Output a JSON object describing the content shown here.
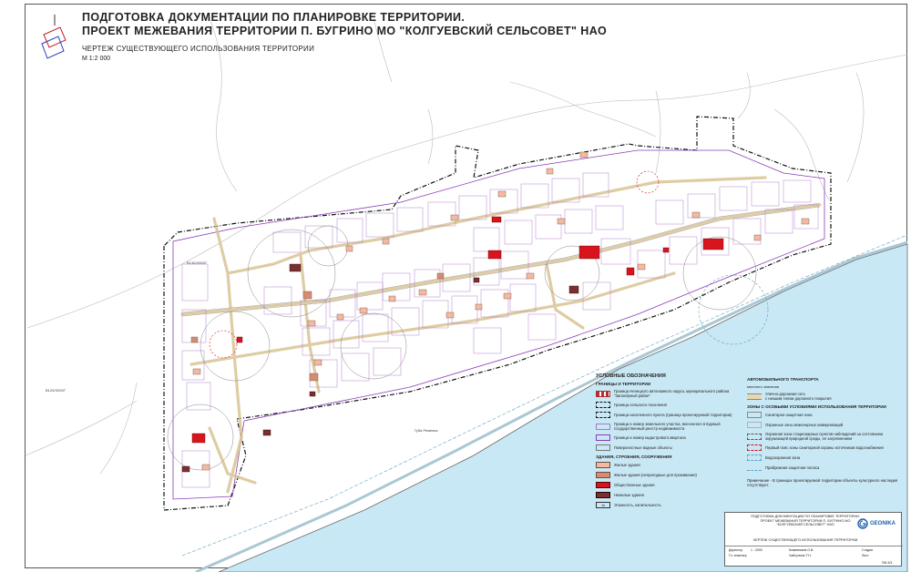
{
  "title": {
    "line1": "ПОДГОТОВКА ДОКУМЕНТАЦИИ ПО ПЛАНИРОВКЕ ТЕРРИТОРИИ.",
    "line2": "ПРОЕКТ МЕЖЕВАНИЯ ТЕРРИТОРИИ  П. БУГРИНО МО \"КОЛГУЕВСКИЙ СЕЛЬСОВЕТ\" НАО",
    "subtitle": "ЧЕРТЕЖ СУЩЕСТВУЮЩЕГО ИСПОЛЬЗОВАНИЯ ТЕРРИТОРИИ",
    "scale": "М 1:2 000"
  },
  "map_labels": {
    "gulf": "Губа Ременка",
    "coord_left": "В120/Х0007",
    "coord_top": "В130/Х0007"
  },
  "colors": {
    "water": "#c9e8f5",
    "residential": "#f4b9a1",
    "residential_unused": "#d58c73",
    "public": "#d8141d",
    "nonresidential": "#7a3030",
    "boundary_purple": "#8a3bb8",
    "road": "#e8d8b0",
    "river": "#aee0f2"
  },
  "legend": {
    "heading": "УСЛОВНЫЕ ОБОЗНАЧЕНИЯ",
    "section_borders": "ГРАНИЦЫ И ТЕРРИТОРИИ",
    "borders": [
      "Граница Ненецкого автономного округа, муниципального района \"Заполярный район\"",
      "Граница сельского поселения",
      "Граница населенного пункта (граница проектируемой территории)",
      "Граница и номер земельного участка, внесенного в Единый государственный реестр недвижимости",
      "Граница и номер кадастрового квартала"
    ],
    "water_label": "Поверхностные водные объекты",
    "section_buildings": "ЗДАНИЯ, СТРОЕНИЯ, СООРУЖЕНИЯ",
    "buildings": [
      "Жилые здания",
      "Жилые здания (непригодные для проживания)",
      "Общественные здания",
      "Нежилые здания",
      "Этажность, капитальность"
    ],
    "floors_badge": "1к",
    "section_roads": "АВТОМОБИЛЬНОГО ТРАНСПОРТА",
    "roads_sub": "местного значения",
    "roads": [
      "Улично-дорожная сеть",
      "с низшим типом дорожного покрытия"
    ],
    "section_zones": "ЗОНЫ С ОСОБЫМИ УСЛОВИЯМИ ИСПОЛЬЗОВАНИЯ ТЕРРИТОРИИ",
    "zones": [
      "Санитарно-защитная зона",
      "Охранные зоны инженерных коммуникаций",
      "Охранная зона стационарных пунктов наблюдений за состоянием окружающей природной среды, ее загрязнением",
      "Первый пояс зоны санитарной охраны источников водоснабжения",
      "Водоохранная зона",
      "Прибрежная защитная полоса"
    ],
    "note": "Примечание - В границах проектируемой территории объекты культурного наследия отсутствуют."
  },
  "stamp": {
    "main_text": "ПОДГОТОВКА ДОКУМЕНТАЦИИ ПО ПЛАНИРОВКЕ ТЕРРИТОРИИ. ПРОЕКТ МЕЖЕВАНИЯ ТЕРРИТОРИИ П. БУГРИНО МО \"КОЛГУЕВСКИЙ СЕЛЬСОВЕТ\" НАО",
    "sub_text": "ЧЕРТЕЖ СУЩЕСТВУЮЩЕГО ИСПОЛЬЗОВАНИЯ ТЕРРИТОРИИ",
    "logo": "GEONIKA",
    "scale_cell": "1 : 2000",
    "role1": "Директор",
    "role2": "Гл. инженер",
    "name1": "Кожевников О.В.",
    "name2": "Чайхунина Т.Н.",
    "col_stage": "Стадия",
    "col_sheet": "Лист",
    "sheet": "ПМ 3/3"
  }
}
